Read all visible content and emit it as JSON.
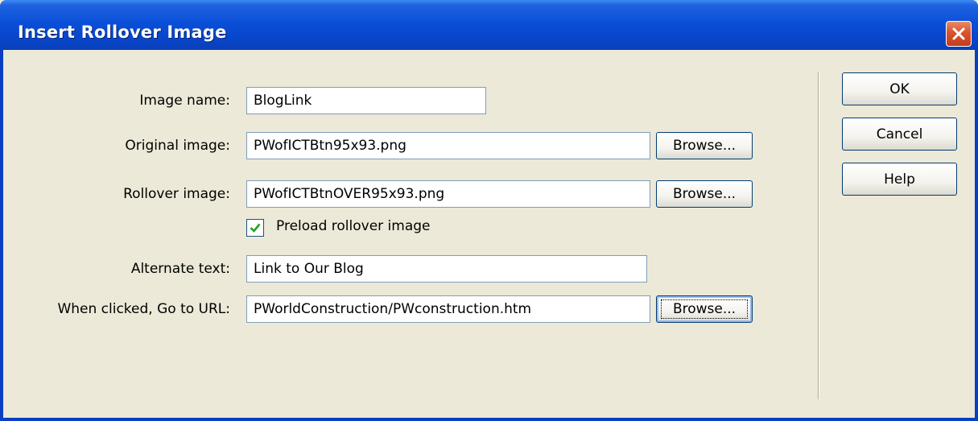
{
  "window": {
    "title": "Insert Rollover Image"
  },
  "form": {
    "image_name": {
      "label": "Image name:",
      "value": "BlogLink"
    },
    "original_image": {
      "label": "Original image:",
      "value": "PWofICTBtn95x93.png",
      "browse_label": "Browse..."
    },
    "rollover_image": {
      "label": "Rollover image:",
      "value": "PWofICTBtnOVER95x93.png",
      "browse_label": "Browse..."
    },
    "preload": {
      "label": "Preload rollover image",
      "checked": true
    },
    "alternate_text": {
      "label": "Alternate text:",
      "value": "Link to Our Blog"
    },
    "url": {
      "label": "When clicked, Go to URL:",
      "value": "PWorldConstruction/PWconstruction.htm",
      "browse_label": "Browse..."
    }
  },
  "buttons": {
    "ok": "OK",
    "cancel": "Cancel",
    "help": "Help"
  },
  "colors": {
    "titlebar": "#0a4fd8",
    "dialog_bg": "#ece9d8",
    "close": "#d8542f",
    "check": "#21a121"
  },
  "icons": {
    "close": "close-icon",
    "check": "checkmark-icon"
  }
}
